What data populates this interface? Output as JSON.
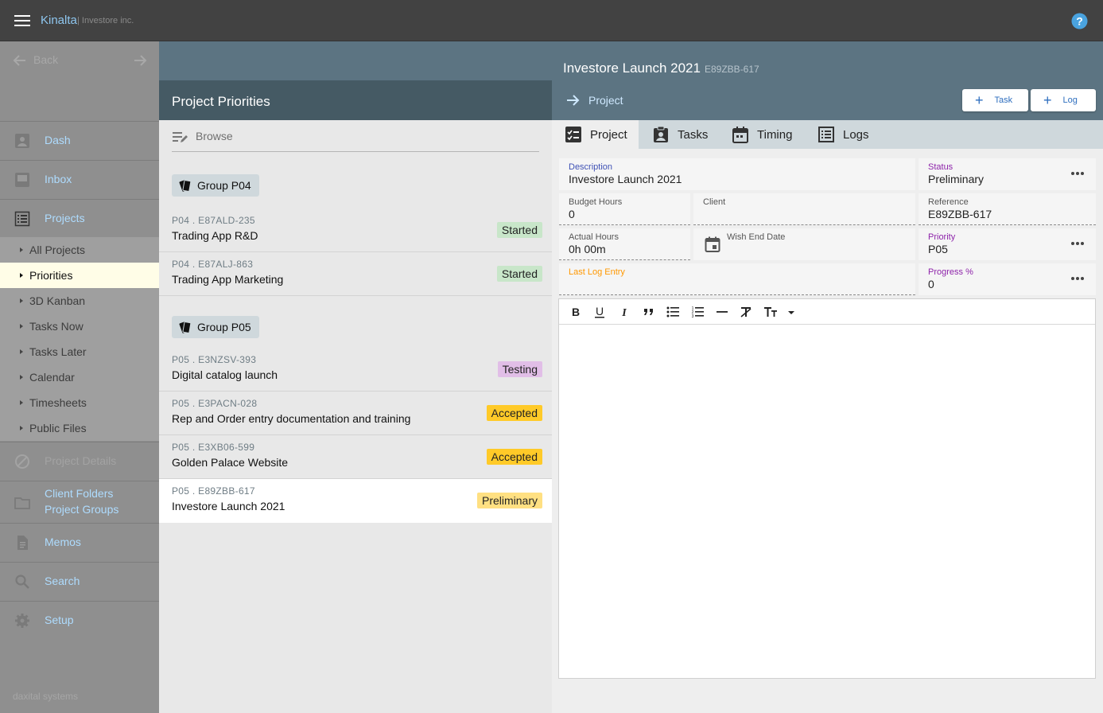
{
  "app": {
    "name": "Kinalta",
    "org": "| Investore inc."
  },
  "nav": {
    "back_label": "Back",
    "items": [
      {
        "label": "Dash",
        "icon": "dashboard-icon"
      },
      {
        "label": "Inbox",
        "icon": "inbox-icon"
      },
      {
        "label": "Projects",
        "icon": "list-icon"
      },
      {
        "label": "Project Details",
        "icon": "block-icon"
      },
      {
        "label": "Client Folders",
        "icon": "folder-icon"
      },
      {
        "label": "Project Groups",
        "icon": "folder-icon"
      },
      {
        "label": "Memos",
        "icon": "document-icon"
      },
      {
        "label": "Search",
        "icon": "search-icon"
      },
      {
        "label": "Setup",
        "icon": "gear-icon"
      }
    ],
    "sub_items": [
      "All Projects",
      "Priorities",
      "3D Kanban",
      "Tasks Now",
      "Tasks Later",
      "Calendar",
      "Timesheets",
      "Public Files"
    ],
    "active_sub": "Priorities",
    "footer": "daxital systems"
  },
  "project_header": {
    "title": "Investore Launch 2021",
    "code": "E89ZBB-617"
  },
  "priorities": {
    "title": "Project Priorities",
    "browse_label": "Browse",
    "groups": [
      {
        "label": "Group P04",
        "rows": [
          {
            "code": "P04 . E87ALD-235",
            "name": "Trading App R&D",
            "status": "Started"
          },
          {
            "code": "P04 . E87ALJ-863",
            "name": "Trading App Marketing",
            "status": "Started"
          }
        ]
      },
      {
        "label": "Group P05",
        "rows": [
          {
            "code": "P05 . E3NZSV-393",
            "name": "Digital catalog launch",
            "status": "Testing"
          },
          {
            "code": "P05 . E3PACN-028",
            "name": "Rep and Order entry documentation and training",
            "status": "Accepted"
          },
          {
            "code": "P05 . E3XB06-599",
            "name": "Golden Palace Website",
            "status": "Accepted"
          },
          {
            "code": "P05 . E89ZBB-617",
            "name": "Investore Launch 2021",
            "status": "Preliminary"
          }
        ]
      }
    ]
  },
  "detail": {
    "heading": "Project",
    "buttons": {
      "task": "Task",
      "log": "Log"
    },
    "tabs": [
      "Project",
      "Tasks",
      "Timing",
      "Logs"
    ],
    "fields": {
      "description": {
        "label": "Description",
        "value": "Investore Launch 2021"
      },
      "status": {
        "label": "Status",
        "value": "Preliminary"
      },
      "budget_hours": {
        "label": "Budget Hours",
        "value": "0"
      },
      "client": {
        "label": "Client",
        "value": ""
      },
      "reference": {
        "label": "Reference",
        "value": "E89ZBB-617"
      },
      "actual_hours": {
        "label": "Actual Hours",
        "value": "0h 00m"
      },
      "wish_end_date": {
        "label": "Wish End Date",
        "value": ""
      },
      "priority": {
        "label": "Priority",
        "value": "P05"
      },
      "last_log_entry": {
        "label": "Last Log Entry",
        "value": ""
      },
      "progress": {
        "label": "Progress %",
        "value": "0"
      }
    }
  },
  "colors": {
    "link": "#aedcff",
    "badge_started": "#c8e6c9",
    "badge_testing": "#e1bee7",
    "badge_accepted": "#ffca28",
    "badge_preliminary": "#ffe082",
    "label_purple": "#8e24aa",
    "label_blue": "#3f51b5",
    "label_orange": "#ff9800"
  }
}
